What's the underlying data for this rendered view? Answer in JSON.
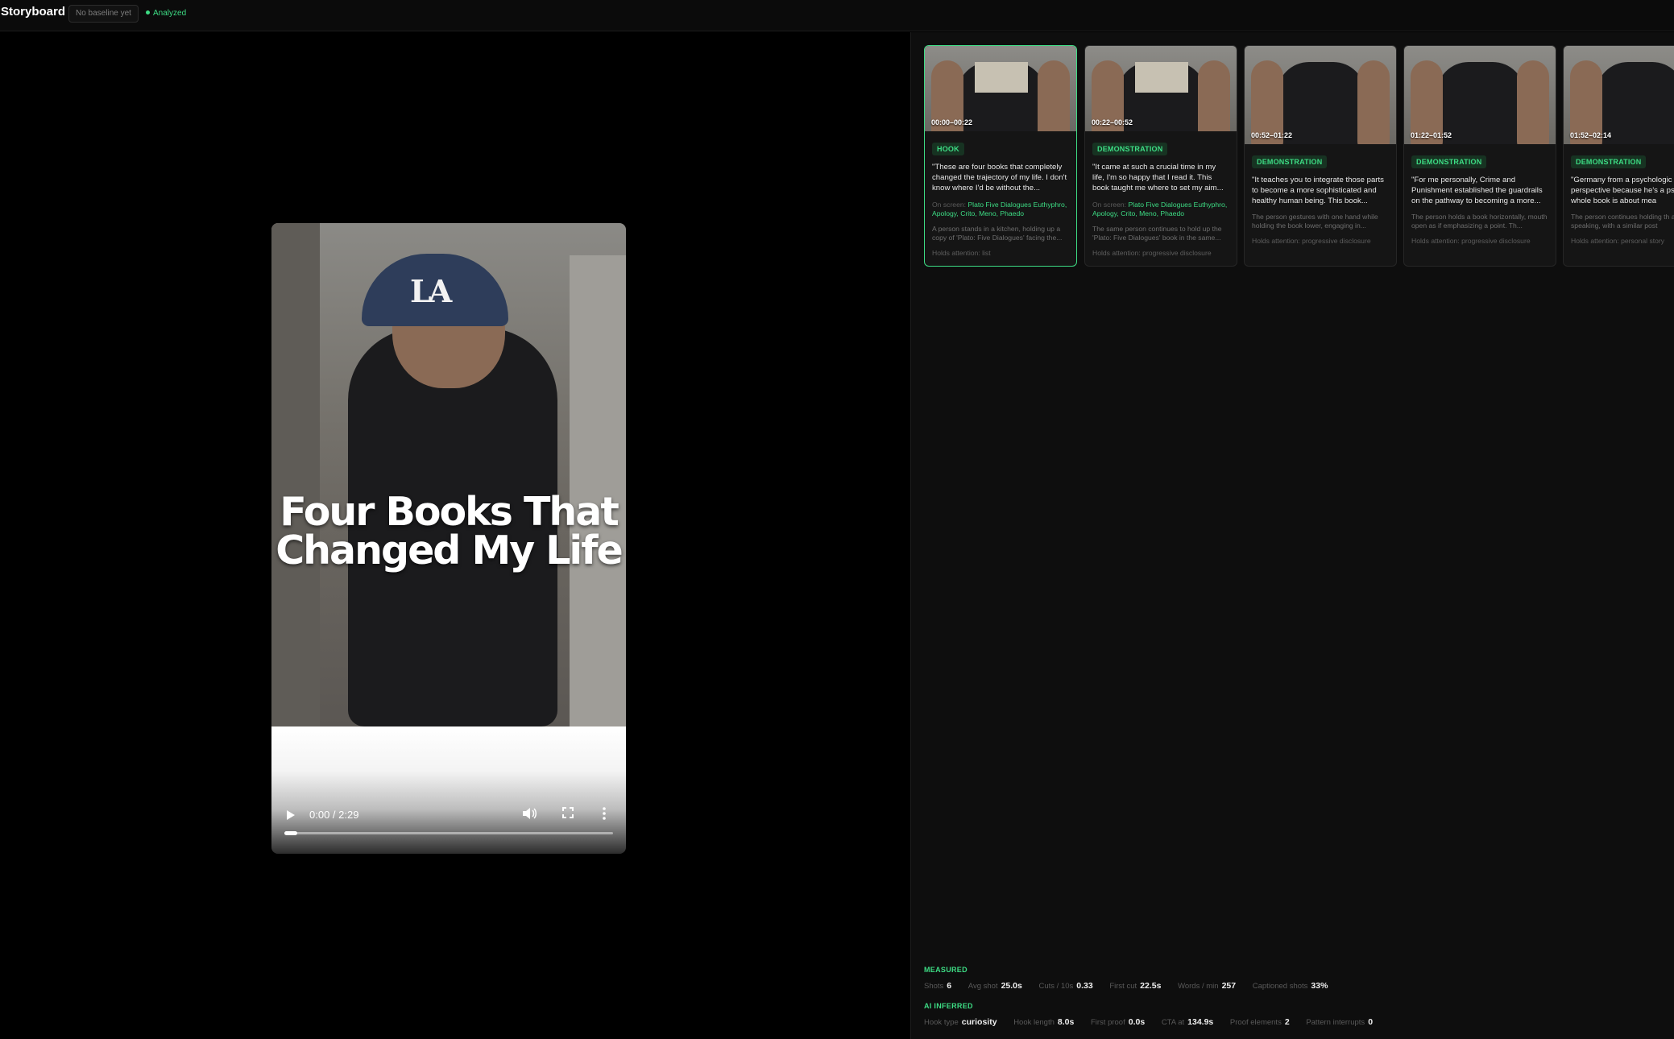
{
  "header": {
    "title": "Storyboard",
    "baseline_pill": "No baseline yet",
    "status": "Analyzed"
  },
  "video": {
    "overlay_line1": "Four Books That",
    "overlay_line2": "Changed My Life",
    "time": "0:00 / 2:29",
    "progress": 0,
    "cap_logo": "LA"
  },
  "shots": [
    {
      "time": "00:00–00:22",
      "tag": "HOOK",
      "quote": "\"These are four books that completely changed the trajectory of my life. I don't know where I'd be without the...",
      "onscreen_label": "On screen:",
      "onscreen": "Plato Five Dialogues Euthyphro, Apology, Crito, Meno, Phaedo",
      "desc": "A person stands in a kitchen, holding up a copy of 'Plato: Five Dialogues' facing the...",
      "holds": "Holds attention: list"
    },
    {
      "time": "00:22–00:52",
      "tag": "DEMONSTRATION",
      "quote": "\"It came at such a crucial time in my life, I'm so happy that I read it. This book taught me where to set my aim...",
      "onscreen_label": "On screen:",
      "onscreen": "Plato Five Dialogues Euthyphro, Apology, Crito, Meno, Phaedo",
      "desc": "The same person continues to hold up the 'Plato: Five Dialogues' book in the same...",
      "holds": "Holds attention: progressive disclosure"
    },
    {
      "time": "00:52–01:22",
      "tag": "DEMONSTRATION",
      "quote": "\"It teaches you to integrate those parts to become a more sophisticated and healthy human being. This book...",
      "desc": "The person gestures with one hand while holding the book lower, engaging in...",
      "holds": "Holds attention: progressive disclosure"
    },
    {
      "time": "01:22–01:52",
      "tag": "DEMONSTRATION",
      "quote": "\"For me personally, Crime and Punishment established the guardrails on the pathway to becoming a more...",
      "desc": "The person holds a book horizontally, mouth open as if emphasizing a point. Th...",
      "holds": "Holds attention: progressive disclosure"
    },
    {
      "time": "01:52–02:14",
      "tag": "DEMONSTRATION",
      "quote": "\"Germany from a psychologic perspective because he's a ps The whole book is about mea",
      "desc": "The person continues holding th and speaking, with a similar post",
      "holds": "Holds attention: personal story"
    }
  ],
  "metrics": {
    "measured_label": "MEASURED",
    "measured": [
      {
        "label": "Shots",
        "value": "6"
      },
      {
        "label": "Avg shot",
        "value": "25.0s"
      },
      {
        "label": "Cuts / 10s",
        "value": "0.33"
      },
      {
        "label": "First cut",
        "value": "22.5s"
      },
      {
        "label": "Words / min",
        "value": "257"
      },
      {
        "label": "Captioned shots",
        "value": "33%"
      }
    ],
    "ai_label": "AI INFERRED",
    "ai": [
      {
        "label": "Hook type",
        "value": "curiosity"
      },
      {
        "label": "Hook length",
        "value": "8.0s"
      },
      {
        "label": "First proof",
        "value": "0.0s"
      },
      {
        "label": "CTA at",
        "value": "134.9s"
      },
      {
        "label": "Proof elements",
        "value": "2"
      },
      {
        "label": "Pattern interrupts",
        "value": "0"
      }
    ]
  },
  "colors": {
    "accent": "#3ddc84",
    "background": "#000000",
    "panel": "#0e0e0e"
  }
}
